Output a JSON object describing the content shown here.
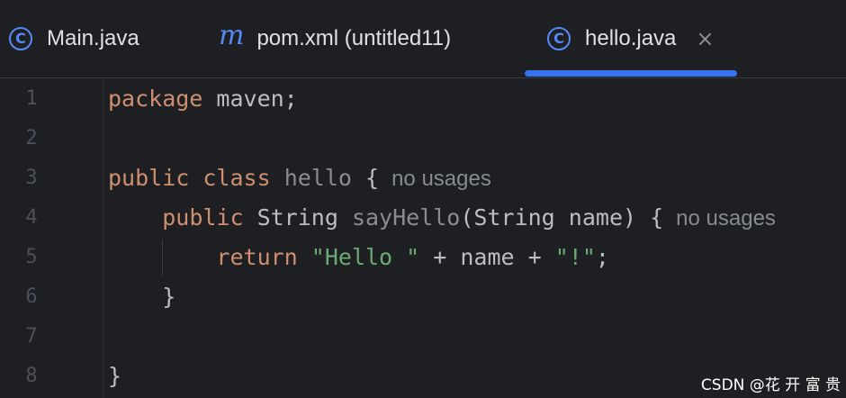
{
  "tabs": [
    {
      "icon": "class-icon",
      "label": "Main.java",
      "active": false
    },
    {
      "icon": "maven-icon",
      "label": "pom.xml (untitled11)",
      "active": false
    },
    {
      "icon": "class-icon",
      "label": "hello.java",
      "active": true,
      "close": "×"
    }
  ],
  "icons": {
    "class_glyph": "C",
    "maven_glyph": "m"
  },
  "accent_color": "#3574f0",
  "line_numbers": [
    "1",
    "2",
    "3",
    "4",
    "5",
    "6",
    "7",
    "8"
  ],
  "code": {
    "line1": {
      "kw": "package",
      "rest": " maven;"
    },
    "line3": {
      "kw1": "public",
      "kw2": "class",
      "name": "hello",
      "brace": " {",
      "hint": "no usages"
    },
    "line4": {
      "indent": "    ",
      "kw": "public",
      "type": " String ",
      "name": "sayHello",
      "params": "(String name) {",
      "hint": "no usages"
    },
    "line5": {
      "indent": "        ",
      "kw": "return",
      "str1": "\"Hello \"",
      "op1": " + name + ",
      "str2": "\"!\"",
      "end": ";"
    },
    "line6": {
      "text": "    }"
    },
    "line8": {
      "text": "}"
    }
  },
  "watermark": "CSDN @花 开 富 贵"
}
